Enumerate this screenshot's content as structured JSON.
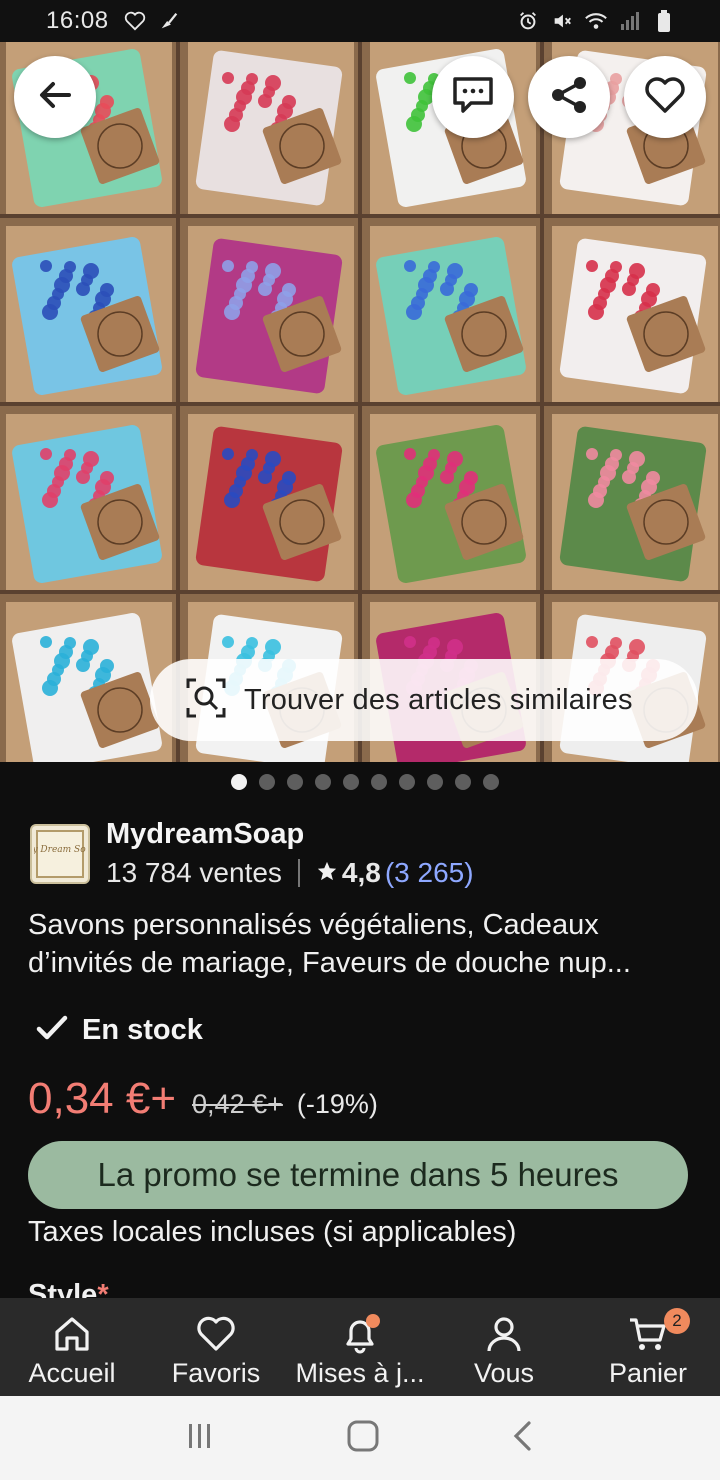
{
  "status_bar": {
    "time": "16:08"
  },
  "hero": {
    "back_button": "arrow-left-icon",
    "message_button": "message-icon",
    "share_button": "share-icon",
    "favorite_button": "heart-icon",
    "similar_label": "Trouver des articles similaires",
    "image_count": 10,
    "active_image": 1
  },
  "shop": {
    "name": "MydreamSoap",
    "logo_text": "My Dream Soap",
    "sales": "13 784 ventes",
    "rating": "4,8",
    "reviews": "(3 265)"
  },
  "listing": {
    "title": "Savons personnalisés végétaliens, Cadeaux d’invités de mariage, Faveurs de douche nup...",
    "stock": "En stock",
    "price": "0,34 €+",
    "old_price": "0,42 €+",
    "discount": "(-19%)",
    "promo": "La promo se termine dans 5 heures",
    "taxes": "Taxes locales incluses (si applicables)",
    "style_label": "Style",
    "style_required": "*"
  },
  "bottom_nav": {
    "items": [
      {
        "label": "Accueil",
        "icon": "home-icon"
      },
      {
        "label": "Favoris",
        "icon": "heart-icon"
      },
      {
        "label": "Mises à j...",
        "icon": "bell-icon"
      },
      {
        "label": "Vous",
        "icon": "user-icon"
      },
      {
        "label": "Panier",
        "icon": "cart-icon",
        "badge": "2"
      }
    ]
  },
  "colors": {
    "price": "#f27d74",
    "promo_bg": "#9bbaa0",
    "link": "#8ea8ff",
    "badge": "#f08a5d"
  }
}
